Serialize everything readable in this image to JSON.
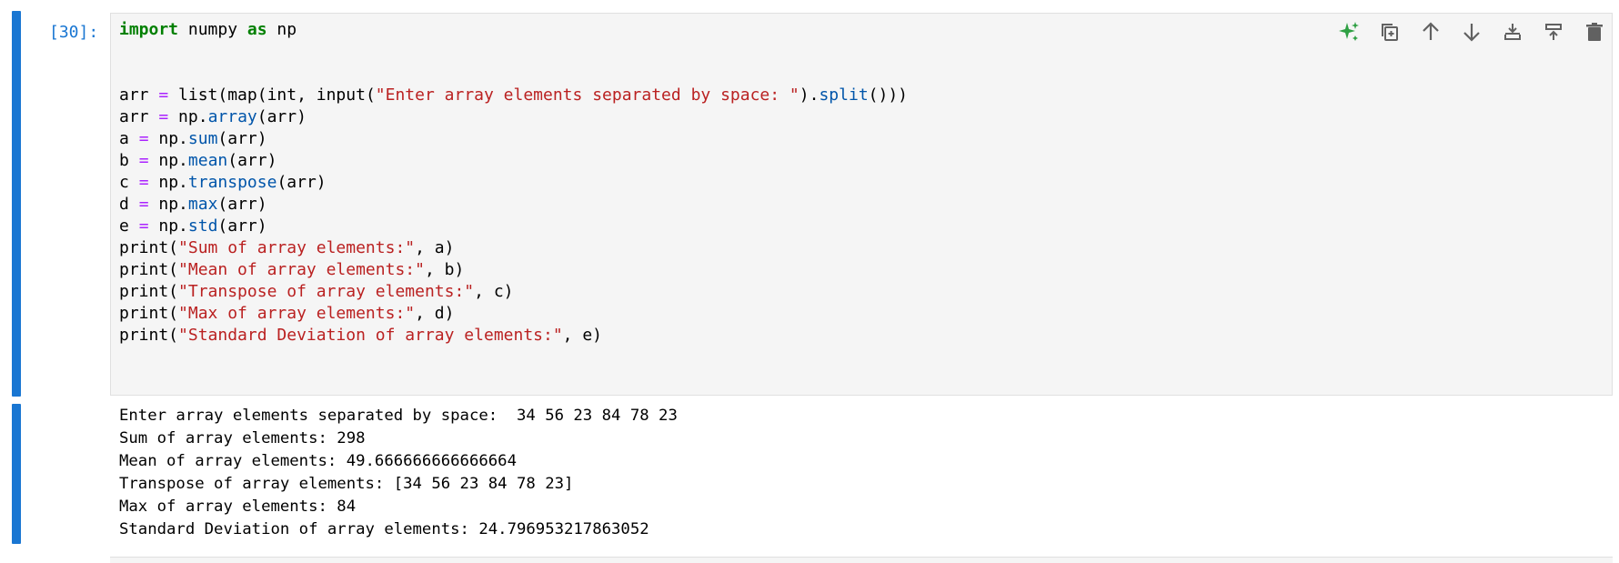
{
  "cell": {
    "prompt": "[30]:",
    "code_lines": [
      [
        {
          "t": "import",
          "c": "kw"
        },
        {
          "t": " numpy ",
          "c": ""
        },
        {
          "t": "as",
          "c": "kw"
        },
        {
          "t": " np",
          "c": ""
        }
      ],
      [],
      [],
      [
        {
          "t": "arr ",
          "c": ""
        },
        {
          "t": "=",
          "c": "op"
        },
        {
          "t": " list(map(int, input(",
          "c": ""
        },
        {
          "t": "\"Enter array elements separated by space: \"",
          "c": "str"
        },
        {
          "t": ").",
          "c": ""
        },
        {
          "t": "split",
          "c": "attr"
        },
        {
          "t": "()))",
          "c": ""
        }
      ],
      [
        {
          "t": "arr ",
          "c": ""
        },
        {
          "t": "=",
          "c": "op"
        },
        {
          "t": " np.",
          "c": ""
        },
        {
          "t": "array",
          "c": "attr"
        },
        {
          "t": "(arr)",
          "c": ""
        }
      ],
      [
        {
          "t": "a ",
          "c": ""
        },
        {
          "t": "=",
          "c": "op"
        },
        {
          "t": " np.",
          "c": ""
        },
        {
          "t": "sum",
          "c": "attr"
        },
        {
          "t": "(arr)",
          "c": ""
        }
      ],
      [
        {
          "t": "b ",
          "c": ""
        },
        {
          "t": "=",
          "c": "op"
        },
        {
          "t": " np.",
          "c": ""
        },
        {
          "t": "mean",
          "c": "attr"
        },
        {
          "t": "(arr)",
          "c": ""
        }
      ],
      [
        {
          "t": "c ",
          "c": ""
        },
        {
          "t": "=",
          "c": "op"
        },
        {
          "t": " np.",
          "c": ""
        },
        {
          "t": "transpose",
          "c": "attr"
        },
        {
          "t": "(arr)",
          "c": ""
        }
      ],
      [
        {
          "t": "d ",
          "c": ""
        },
        {
          "t": "=",
          "c": "op"
        },
        {
          "t": " np.",
          "c": ""
        },
        {
          "t": "max",
          "c": "attr"
        },
        {
          "t": "(arr)",
          "c": ""
        }
      ],
      [
        {
          "t": "e ",
          "c": ""
        },
        {
          "t": "=",
          "c": "op"
        },
        {
          "t": " np.",
          "c": ""
        },
        {
          "t": "std",
          "c": "attr"
        },
        {
          "t": "(arr)",
          "c": ""
        }
      ],
      [
        {
          "t": "print(",
          "c": ""
        },
        {
          "t": "\"Sum of array elements:\"",
          "c": "str"
        },
        {
          "t": ", a)",
          "c": ""
        }
      ],
      [
        {
          "t": "print(",
          "c": ""
        },
        {
          "t": "\"Mean of array elements:\"",
          "c": "str"
        },
        {
          "t": ", b)",
          "c": ""
        }
      ],
      [
        {
          "t": "print(",
          "c": ""
        },
        {
          "t": "\"Transpose of array elements:\"",
          "c": "str"
        },
        {
          "t": ", c)",
          "c": ""
        }
      ],
      [
        {
          "t": "print(",
          "c": ""
        },
        {
          "t": "\"Max of array elements:\"",
          "c": "str"
        },
        {
          "t": ", d)",
          "c": ""
        }
      ],
      [
        {
          "t": "print(",
          "c": ""
        },
        {
          "t": "\"Standard Deviation of array elements:\"",
          "c": "str"
        },
        {
          "t": ", e)",
          "c": ""
        }
      ]
    ],
    "output_lines": [
      "Enter array elements separated by space:  34 56 23 84 78 23",
      "Sum of array elements: 298",
      "Mean of array elements: 49.666666666666664",
      "Transpose of array elements: [34 56 23 84 78 23]",
      "Max of array elements: 84",
      "Standard Deviation of array elements: 24.796953217863052"
    ]
  },
  "toolbar": {
    "buttons": [
      {
        "name": "sparkle-ai-icon",
        "color": "#2ea043"
      },
      {
        "name": "duplicate-cell-icon",
        "color": "#616161"
      },
      {
        "name": "move-up-icon",
        "color": "#616161"
      },
      {
        "name": "move-down-icon",
        "color": "#616161"
      },
      {
        "name": "insert-cell-above-icon",
        "color": "#616161"
      },
      {
        "name": "insert-cell-below-icon",
        "color": "#616161"
      },
      {
        "name": "delete-cell-icon",
        "color": "#616161"
      }
    ]
  },
  "colors": {
    "accent": "#1976d2",
    "keyword": "#008000",
    "operator": "#aa22ff",
    "string": "#ba2121",
    "attribute": "#0055aa",
    "editor_bg": "#f5f5f5"
  }
}
